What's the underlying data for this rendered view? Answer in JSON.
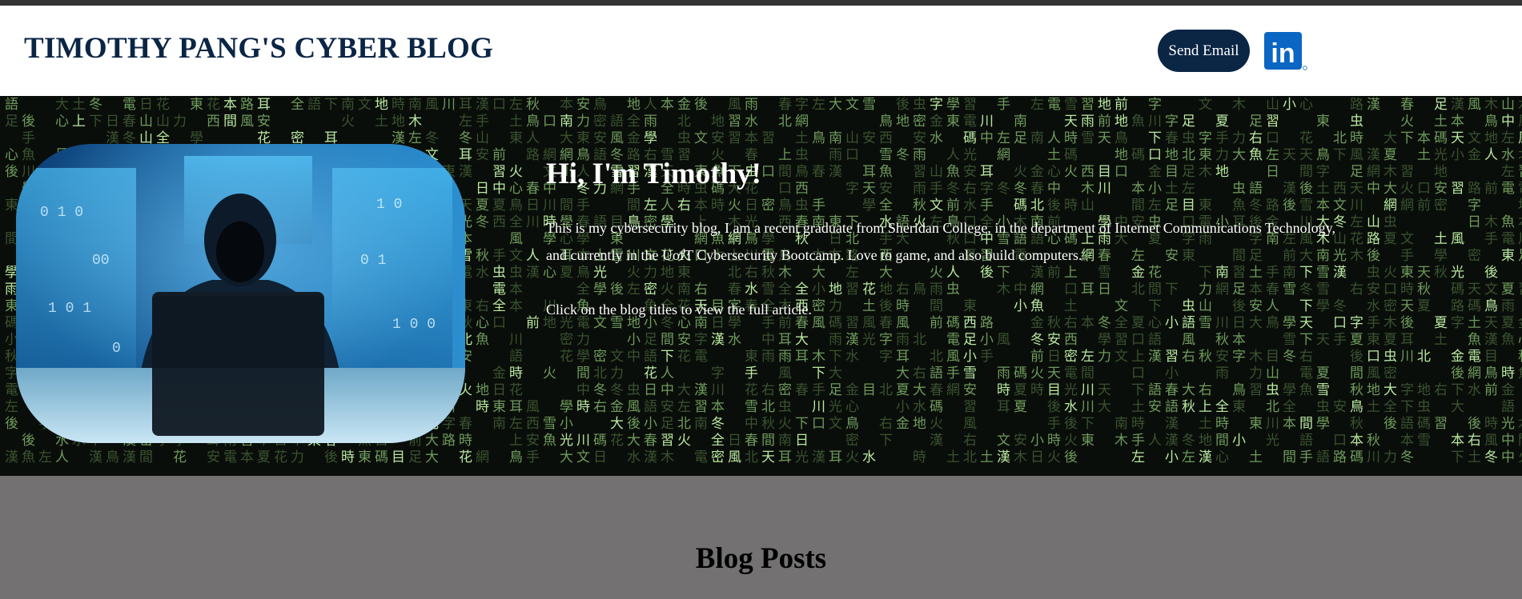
{
  "header": {
    "title": "TIMOTHY PANG'S CYBER BLOG",
    "email_button_label": "Send Email",
    "linkedin_icon": "linkedin-icon",
    "linkedin_text": "in"
  },
  "hero": {
    "heading": "Hi, I'm Timothy!",
    "paragraph1": "This is my cybersecurity blog, I am a recent graduate from Sheridan College, in the department of Internet Communications Technology, and currently in the UofT Cybersecurity Bootcamp. Love to game, and also build computers.",
    "paragraph2": "Click on the blog titles to view the full article.",
    "image_name": "hooded-hacker-image"
  },
  "blog_section": {
    "title": "Blog Posts"
  },
  "colors": {
    "brand_navy": "#0b2545",
    "matrix_green": "#7fbf6a",
    "section_gray": "#737172",
    "linkedin_blue": "#0a66c2"
  }
}
